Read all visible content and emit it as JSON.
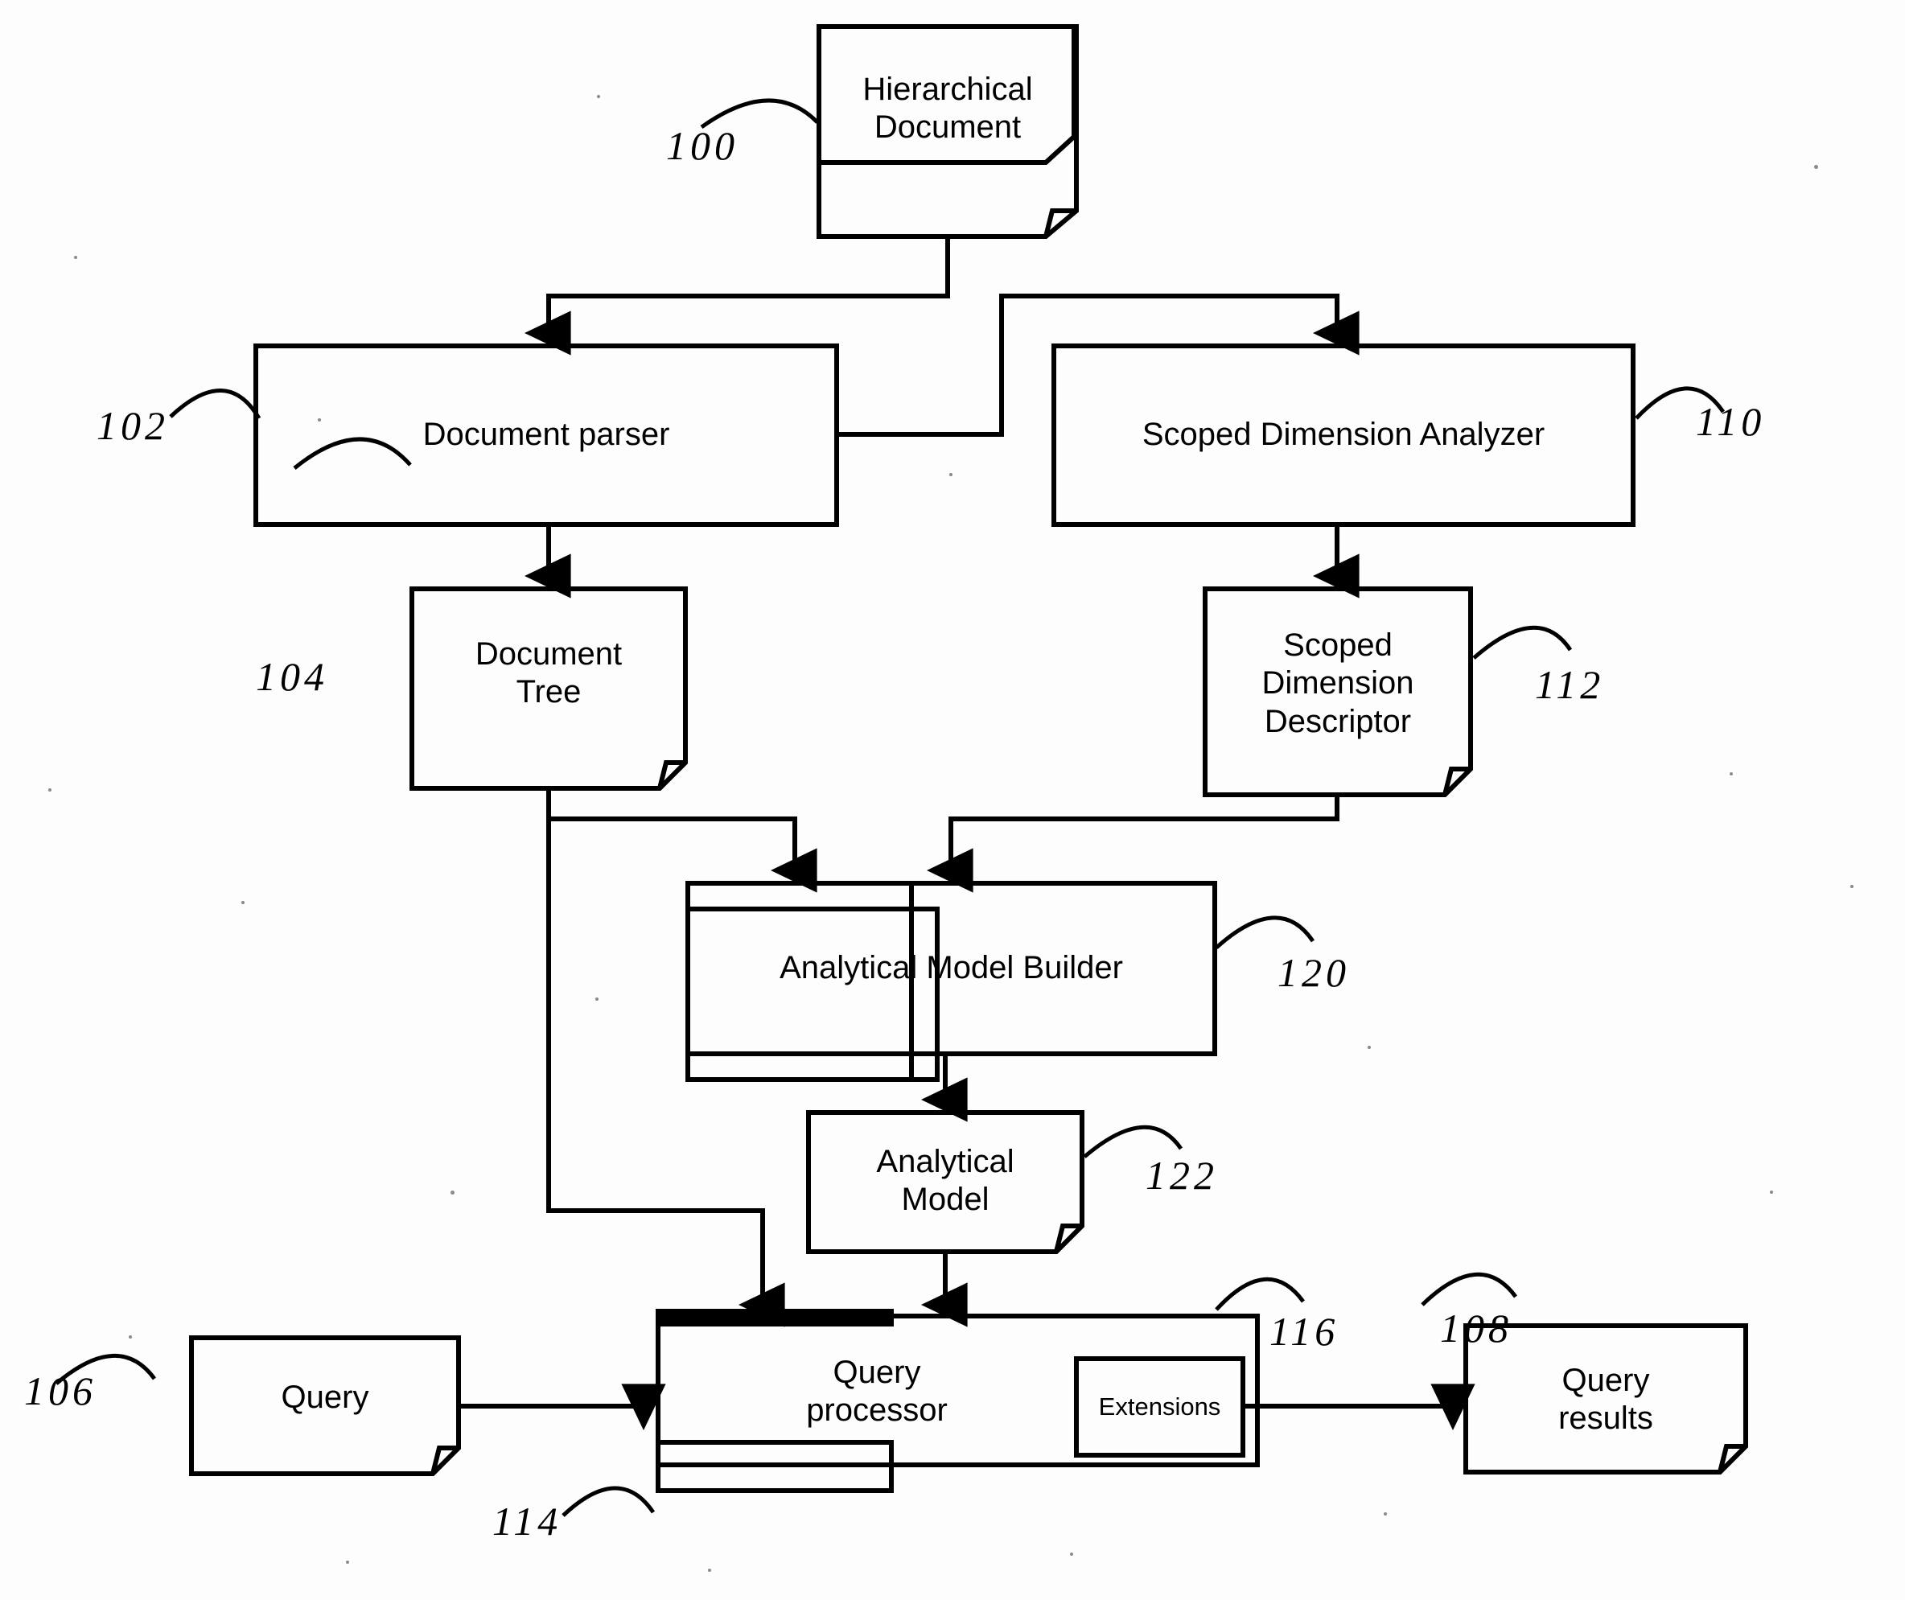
{
  "figure": {
    "type": "patent-flow-diagram",
    "background_color": "#fdfdfd",
    "stroke_color": "#000000"
  },
  "nodes": [
    {
      "id": "hierarchical-document",
      "label": "Hierarchical\nDocument",
      "shape": "document",
      "ref": "100"
    },
    {
      "id": "document-parser",
      "label": "Document parser",
      "shape": "rect",
      "ref": "102"
    },
    {
      "id": "scoped-dimension-analyzer",
      "label": "Scoped Dimension Analyzer",
      "shape": "rect",
      "ref": "110"
    },
    {
      "id": "document-tree",
      "label": "Document\nTree",
      "shape": "document",
      "ref": "104"
    },
    {
      "id": "scoped-dimension-descriptor",
      "label": "Scoped\nDimension\nDescriptor",
      "shape": "document",
      "ref": "112"
    },
    {
      "id": "analytical-model-builder",
      "label": "Analytical Model Builder",
      "shape": "stacked-rect",
      "ref": "120"
    },
    {
      "id": "analytical-model",
      "label": "Analytical\nModel",
      "shape": "document",
      "ref": "122"
    },
    {
      "id": "query",
      "label": "Query",
      "shape": "document",
      "ref": "106"
    },
    {
      "id": "query-processor",
      "label": "Query\nprocessor",
      "shape": "stacked-rect",
      "ref": "114"
    },
    {
      "id": "extensions",
      "label": "Extensions",
      "shape": "rect",
      "ref": "116"
    },
    {
      "id": "query-results",
      "label": "Query\nresults",
      "shape": "document",
      "ref": "108"
    }
  ],
  "reference_numerals": {
    "n100": "100",
    "n102": "102",
    "n104": "104",
    "n106": "106",
    "n108": "108",
    "n110": "110",
    "n112": "112",
    "n114": "114",
    "n116": "116",
    "n120": "120",
    "n122": "122"
  },
  "labels": {
    "hierarchical_document": "Hierarchical\nDocument",
    "document_parser": "Document parser",
    "scoped_dimension_analyzer": "Scoped Dimension Analyzer",
    "document_tree": "Document\nTree",
    "scoped_dimension_descriptor": "Scoped\nDimension\nDescriptor",
    "analytical_model_builder": "Analytical Model Builder",
    "analytical_model": "Analytical\nModel",
    "query": "Query",
    "query_processor": "Query\nprocessor",
    "extensions": "Extensions",
    "query_results": "Query\nresults"
  },
  "edges": [
    {
      "from": "hierarchical-document",
      "to": "document-parser",
      "arrow": true
    },
    {
      "from": "document-parser",
      "to": "scoped-dimension-analyzer",
      "arrow": true
    },
    {
      "from": "document-parser",
      "to": "document-tree",
      "arrow": true
    },
    {
      "from": "scoped-dimension-analyzer",
      "to": "scoped-dimension-descriptor",
      "arrow": true
    },
    {
      "from": "document-tree",
      "to": "analytical-model-builder",
      "arrow": true
    },
    {
      "from": "scoped-dimension-descriptor",
      "to": "analytical-model-builder",
      "arrow": true
    },
    {
      "from": "analytical-model-builder",
      "to": "analytical-model",
      "arrow": true
    },
    {
      "from": "document-tree",
      "to": "query-processor",
      "arrow": true
    },
    {
      "from": "analytical-model",
      "to": "query-processor",
      "arrow": true
    },
    {
      "from": "query",
      "to": "query-processor",
      "arrow": true
    },
    {
      "from": "extensions",
      "to": "query-results",
      "arrow": true
    }
  ]
}
